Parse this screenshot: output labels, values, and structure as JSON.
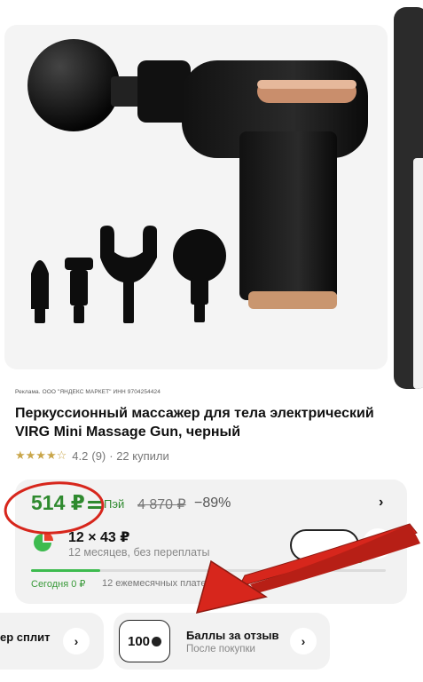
{
  "ad": {
    "text": "Реклама. ООО \"ЯНДЕКС МАРКЕТ\" ИНН 9704254424"
  },
  "product": {
    "title": "Перкуссионный массажер для тела электрический VIRG Mini Massage Gun, черный",
    "stars": "★★★★☆",
    "rating": "4.2",
    "reviews": "(9)",
    "bought": "· 22 купили"
  },
  "price": {
    "current": "514 ₽",
    "pay_label": "Пэй",
    "old": "4 870 ₽",
    "discount": "−89%"
  },
  "split": {
    "amount": "12 × 43 ₽",
    "subtitle": "12 месяцев, без переплаты",
    "today": "Сегодня 0 ₽",
    "monthly": "12 ежемесячных плате"
  },
  "chips": {
    "left_label": "ер сплит",
    "points_value": "100",
    "points_label": "Баллы за отзыв",
    "points_sub": "После покупки"
  },
  "colors": {
    "accent_green": "#2f8a2f",
    "annotation_red": "#d7261c",
    "star_gold": "#c9a64a"
  }
}
